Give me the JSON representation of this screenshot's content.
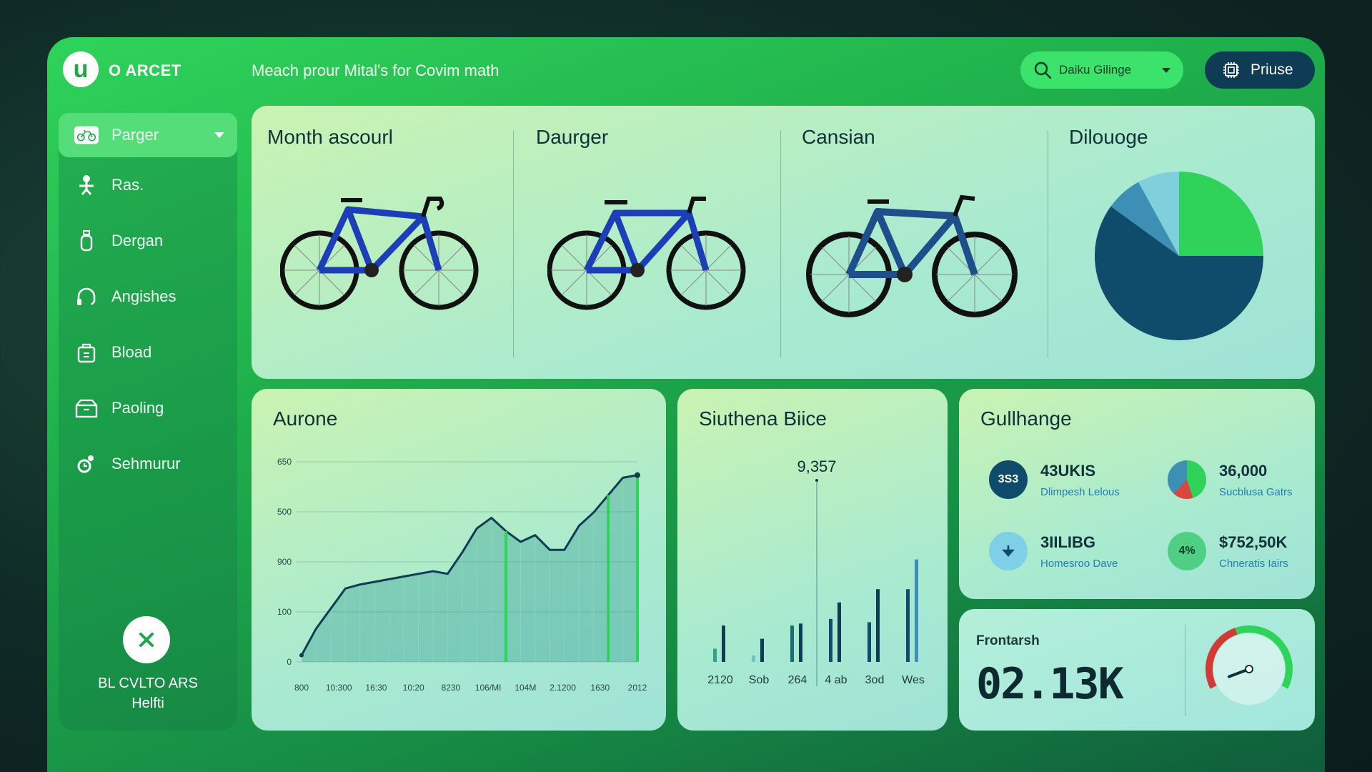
{
  "header": {
    "brand": "O ARCET",
    "headline": "Meach prour Mital's for Covim math",
    "search_label": "Daiku Gilinge",
    "prime_label": "Priuse"
  },
  "sidebar": {
    "items": [
      {
        "label": "Parger",
        "icon": "bike-icon",
        "active": true
      },
      {
        "label": "Ras.",
        "icon": "person-icon"
      },
      {
        "label": "Dergan",
        "icon": "bottle-icon"
      },
      {
        "label": "Angishes",
        "icon": "headset-icon"
      },
      {
        "label": "Bload",
        "icon": "bag-icon"
      },
      {
        "label": "Paoling",
        "icon": "box-icon"
      },
      {
        "label": "Sehmurur",
        "icon": "gear-person-icon"
      }
    ],
    "footer_line1": "BL CVLTO ARS",
    "footer_line2": "Helfti"
  },
  "top_panel": {
    "columns": [
      {
        "title": "Month ascourl"
      },
      {
        "title": "Daurger"
      },
      {
        "title": "Cansian"
      },
      {
        "title": "Dilouoge"
      }
    ]
  },
  "colors": {
    "frame_green": "#22c155",
    "navy": "#0f4c6b",
    "pie_light_green": "#2fd35a",
    "pie_blue": "#3d8fb5",
    "pie_light_blue": "#7fd0dc",
    "bike_blue": "#1c3fb8",
    "bike_teal": "#1f4f8a"
  },
  "line_panel": {
    "title": "Aurone"
  },
  "bar_panel": {
    "title": "Siuthena Biice",
    "peak_label": "9,357"
  },
  "kpi_panel": {
    "title": "Gullhange",
    "items": [
      {
        "badge": "3S3",
        "value": "43UKIS",
        "label": "Dlimpesh Lelous"
      },
      {
        "badge": "",
        "value": "36,000",
        "label": "Sucblusa Gatrs"
      },
      {
        "badge": "",
        "value": "3IILIBG",
        "label": "Homesroo Dave"
      },
      {
        "badge": "4%",
        "value": "$752,50K",
        "label": "Chneratis Iairs"
      }
    ]
  },
  "gauge_panel": {
    "label": "Frontarsh",
    "value": "02.13K",
    "gauge_level": 0.45
  },
  "chart_data": [
    {
      "type": "pie",
      "title": "Dilouoge",
      "values": [
        25,
        60,
        7,
        8
      ],
      "colors": [
        "#2fd35a",
        "#0f4c6b",
        "#3d8fb5",
        "#7fd0dc"
      ]
    },
    {
      "type": "area",
      "title": "Aurone",
      "x": [
        "800",
        "10:300",
        "16:30",
        "10:20",
        "8230",
        "106/MI",
        "104M",
        "2.1200",
        "1630",
        "2012"
      ],
      "y_ticks": [
        "650",
        "500",
        "900",
        "100",
        "0"
      ],
      "values": [
        5,
        25,
        40,
        55,
        58,
        60,
        62,
        64,
        66,
        68,
        66,
        82,
        100,
        108,
        98,
        90,
        95,
        84,
        84,
        102,
        112,
        125,
        138,
        140
      ],
      "highlight_indices": [
        14,
        21,
        23
      ],
      "ylim": [
        0,
        150
      ]
    },
    {
      "type": "bar",
      "title": "Siuthena Biice",
      "categories": [
        "2120",
        "Sob",
        "264",
        "4 ab",
        "3od",
        "Wes"
      ],
      "series": [
        {
          "values": [
            20,
            10,
            55,
            65,
            60,
            110
          ]
        },
        {
          "values": [
            55,
            35,
            58,
            90,
            110,
            155
          ]
        }
      ],
      "peak_value": "9,357",
      "ylim": [
        0,
        240
      ]
    }
  ]
}
